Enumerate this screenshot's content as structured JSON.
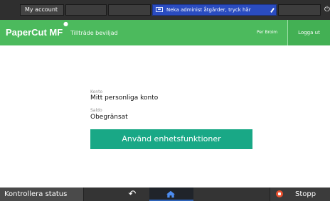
{
  "system_bar": {
    "account_button": "My account",
    "notice": "Neka administ åtgärder, tryck här"
  },
  "header": {
    "logo": "PaperCut MF",
    "title": "Tillträde beviljad",
    "user": "Per Broim",
    "logout": "Logga ut"
  },
  "account": {
    "label": "Konto",
    "value": "Mitt personliga konto"
  },
  "balance": {
    "label": "Saldo",
    "value": "Obegränsat"
  },
  "main": {
    "primary_button": "Använd enhetsfunktioner"
  },
  "bottom_bar": {
    "status_button": "Kontrollera status",
    "stop_button": "Stopp"
  },
  "colors": {
    "header": "#4cba5d",
    "primary_button": "#19a886",
    "system_bar": "#2f2f2f",
    "notice": "#2a4cc0",
    "stop_icon": "#e9512f",
    "home_highlight": "#2d62b7"
  },
  "icons": {
    "notice": "notice-icon",
    "power": "power-icon",
    "back": "back-icon",
    "home": "home-icon",
    "stop": "stop-icon"
  }
}
